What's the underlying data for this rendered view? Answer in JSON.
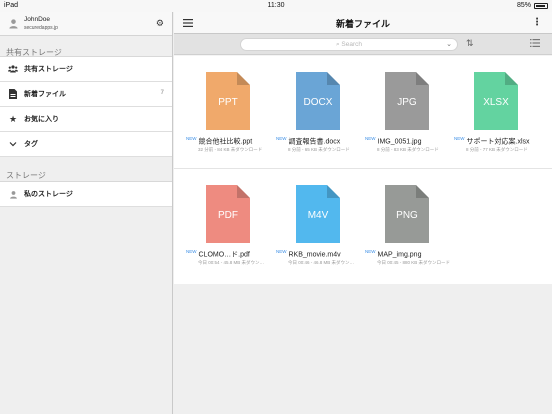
{
  "status_bar": {
    "carrier": "iPad",
    "time": "11:30",
    "battery": "85%"
  },
  "sidebar": {
    "user": {
      "name": "JohnDoe",
      "domain": "securedapps.jp"
    },
    "shared_section": "共有ストレージ",
    "items": [
      {
        "label": "共有ストレージ",
        "icon": "group-icon",
        "badge": ""
      },
      {
        "label": "新着ファイル",
        "icon": "new-file-icon",
        "badge": "7"
      },
      {
        "label": "お気に入り",
        "icon": "star-icon",
        "badge": ""
      },
      {
        "label": "タグ",
        "icon": "chevron-down-icon",
        "badge": ""
      }
    ],
    "storage_section": "ストレージ",
    "storage_items": [
      {
        "label": "私のストレージ",
        "icon": "person-icon"
      }
    ]
  },
  "main": {
    "title": "新着ファイル",
    "more": "⋮",
    "search": {
      "placeholder": "Search"
    },
    "files": [
      {
        "ext": "PPT",
        "color": "#f0a96b",
        "name": "競合他社比較.ppt",
        "new": "NEW",
        "meta": "32 分前 - 84 KB   未ダウンロード"
      },
      {
        "ext": "DOCX",
        "color": "#6aa5d6",
        "name": "調査報告書.docx",
        "new": "NEW",
        "meta": "8 分前 - 65 KB   未ダウンロード"
      },
      {
        "ext": "JPG",
        "color": "#9a9a9a",
        "name": "IMG_0051.jpg",
        "new": "NEW",
        "meta": "8 分前 - 83 KB   未ダウンロード"
      },
      {
        "ext": "XLSX",
        "color": "#63d3a0",
        "name": "サポート対応案.xlsx",
        "new": "NEW",
        "meta": "8 分前 - 77 KB   未ダウンロード"
      },
      {
        "ext": "PDF",
        "color": "#ee8b80",
        "name": "CLOMO…ド.pdf",
        "new": "NEW",
        "meta": "今日 00:54 - 45.8 MB   未ダウン…"
      },
      {
        "ext": "M4V",
        "color": "#52b8ee",
        "name": "RKB_movie.m4v",
        "new": "NEW",
        "meta": "今日 00:46 - 46.8 MB   未ダウン…"
      },
      {
        "ext": "PNG",
        "color": "#979a97",
        "name": "MAP_img.png",
        "new": "NEW",
        "meta": "今日 00:45 - 880 KB   未ダウンロード"
      }
    ]
  }
}
